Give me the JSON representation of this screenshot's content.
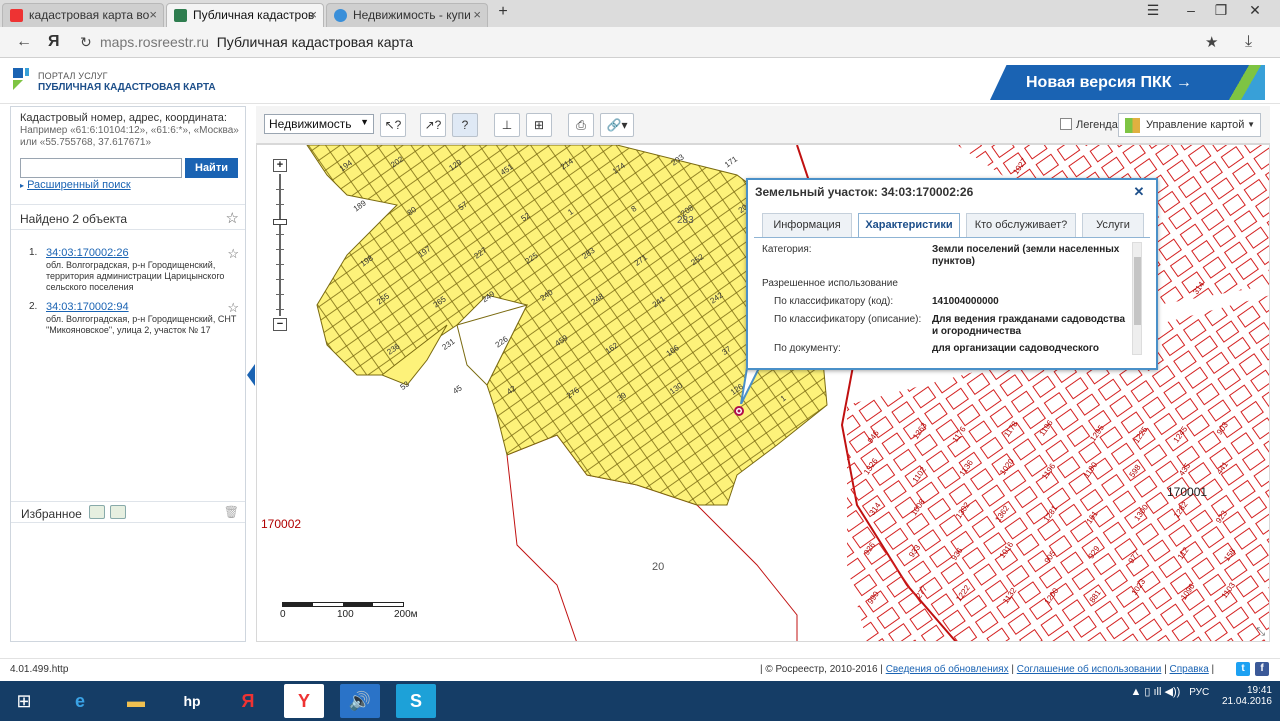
{
  "browser": {
    "tabs": [
      {
        "label": "кадастровая карта во",
        "active": false
      },
      {
        "label": "Публичная кадастров",
        "active": true
      },
      {
        "label": "Недвижимость - купи",
        "active": false
      }
    ],
    "new_tab": "+",
    "url_domain": "maps.rosreestr.ru",
    "url_title": "Публичная кадастровая карта"
  },
  "header": {
    "logo_top": "ПОРТАЛ УСЛУГ",
    "logo_bottom": "ПУБЛИЧНАЯ КАДАСТРОВАЯ КАРТА",
    "new_version": "Новая версия ПКК →"
  },
  "search": {
    "label": "Кадастровый номер, адрес, координата:",
    "example": "Например «61:6:10104:12», «61:6:*», «Москва» или «55.755768, 37.617671»",
    "input_value": "",
    "button": "Найти",
    "advanced": "Расширенный поиск"
  },
  "results": {
    "header": "Найдено 2 объекта",
    "items": [
      {
        "num": "1.",
        "link": "34:03:170002:26",
        "desc": "обл. Волгоградская, р-н Городищенский, территория администрации Царицынского сельского поселения"
      },
      {
        "num": "2.",
        "link": "34:03:170002:94",
        "desc": "обл. Волгоградская, р-н Городищенский, СНТ \"Микояновское\", улица 2, участок № 17"
      }
    ]
  },
  "favorites": {
    "label": "Избранное"
  },
  "toolbar": {
    "layer_select": "Недвижимость",
    "legend": "Легенда",
    "map_management": "Управление картой"
  },
  "map": {
    "quarter_west": "170002",
    "quarter_east": "170001",
    "parcel_20": "20",
    "yellow_283": "283",
    "scale": [
      "0",
      "100",
      "200м"
    ],
    "zoom_in": "+",
    "zoom_out": "−",
    "yellow_labels": [
      "194",
      "202",
      "129",
      "451",
      "214",
      "174",
      "203",
      "171",
      "189",
      "80",
      "57",
      "52",
      "1",
      "8",
      "208",
      "200",
      "198",
      "197",
      "227",
      "225",
      "283",
      "271",
      "252",
      "276",
      "255",
      "265",
      "249",
      "240",
      "248",
      "241",
      "242",
      "237",
      "236",
      "231",
      "226",
      "459",
      "162",
      "166",
      "37",
      "60",
      "53",
      "45",
      "42",
      "276",
      "39",
      "130",
      "126",
      "1"
    ],
    "red_labels": [
      "946",
      "1263",
      "1176",
      "1178",
      "1196",
      "1295",
      "1225",
      "1245",
      "903",
      "1326",
      "1102",
      "1136",
      "1020",
      "1196",
      "1190",
      "598",
      "435",
      "441",
      "314",
      "1008",
      "1302",
      "1362",
      "1281",
      "161",
      "1300",
      "1282",
      "923",
      "926",
      "933",
      "936",
      "1016",
      "905",
      "929",
      "977",
      "112",
      "158",
      "990",
      "277",
      "1222",
      "1132",
      "1200",
      "881",
      "1023",
      "1096",
      "1103",
      "1027",
      "763",
      "451",
      "314"
    ]
  },
  "popup": {
    "title": "Земельный участок: 34:03:170002:26",
    "tabs": [
      "Информация",
      "Характеристики",
      "Кто обслуживает?",
      "Услуги"
    ],
    "active_tab": "Характеристики",
    "rows": {
      "category_label": "Категория:",
      "category_value": "Земли поселений (земли населенных пунктов)",
      "permitted_use": "Разрешенное использование",
      "by_code_label": "По классификатору (код):",
      "by_code_value": "141004000000",
      "by_desc_label": "По классификатору (описание):",
      "by_desc_value": "Для ведения гражданами садоводства и огородничества",
      "by_doc_label": "По документу:",
      "by_doc_value": "для организации садоводческого"
    }
  },
  "status": {
    "version": "4.01.499.http",
    "copyright": "| © Росреестр, 2010-2016 |",
    "link1": "Сведения об обновлениях",
    "sep1": "|",
    "link2": "Соглашение об использовании",
    "sep2": "|",
    "link3": "Справка",
    "sep3": "|"
  },
  "taskbar": {
    "lang": "РУС",
    "time": "19:41",
    "date": "21.04.2016"
  },
  "colors": {
    "accent_blue": "#1a63b3",
    "parcel_yellow": "#fdf27a",
    "parcel_red": "#d42020"
  }
}
